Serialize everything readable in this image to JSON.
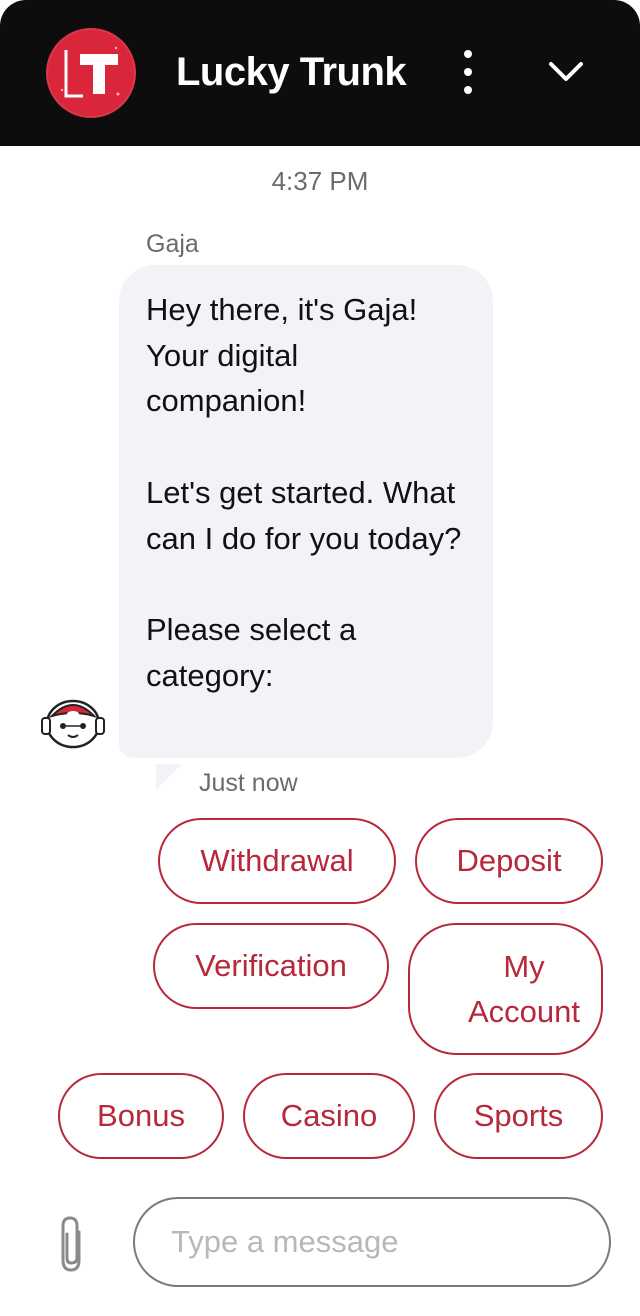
{
  "header": {
    "brand_initials": "LT",
    "title": "Lucky Trunk",
    "menu_icon": "more-vertical-icon",
    "collapse_icon": "chevron-down-icon",
    "background": "#0d0d0d",
    "logo_color": "#d9263a"
  },
  "conversation": {
    "timestamp": "4:37 PM",
    "sender": "Gaja",
    "message_paragraphs": [
      "Hey there, it's Gaja! Your digital companion!",
      "Let's get started. What can I do for you today?",
      "Please select a category:"
    ],
    "message_status": "Just now",
    "bot_avatar_icon": "robot-avatar-icon"
  },
  "quick_replies": [
    {
      "label": "Withdrawal"
    },
    {
      "label": "Deposit"
    },
    {
      "label": "Verification"
    },
    {
      "label": "My Account"
    },
    {
      "label": "Bonus"
    },
    {
      "label": "Casino"
    },
    {
      "label": "Sports"
    }
  ],
  "composer": {
    "attach_icon": "paperclip-icon",
    "placeholder": "Type a message",
    "value": ""
  },
  "colors": {
    "accent": "#b7283a",
    "bubble_bg": "#f1f3f7",
    "muted_text": "#6b6b6b"
  }
}
